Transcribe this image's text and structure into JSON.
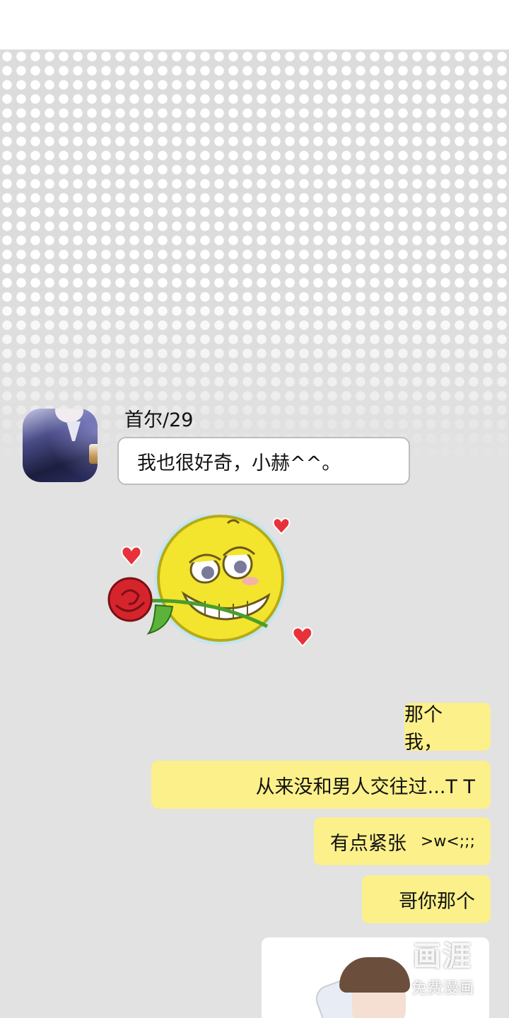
{
  "chat": {
    "sender_name": "首尔/29",
    "incoming_message": "我也很好奇，小赫^^。",
    "outgoing_messages": [
      {
        "text": "那个我，",
        "extra": ""
      },
      {
        "text": "从来没和男人交往过...T T",
        "extra": ""
      },
      {
        "text": "有点紧张",
        "extra": ">w<;;;"
      },
      {
        "text": "哥你那个",
        "extra": ""
      }
    ]
  },
  "watermark": {
    "logo": "画涯",
    "tagline": "免费漫画"
  },
  "colors": {
    "outgoing_bubble": "#fbf08a",
    "incoming_bubble": "#ffffff",
    "background": "#e2e2e2"
  },
  "icons": {
    "sticker": "smiley-with-rose-sticker",
    "heart": "heart-icon"
  }
}
